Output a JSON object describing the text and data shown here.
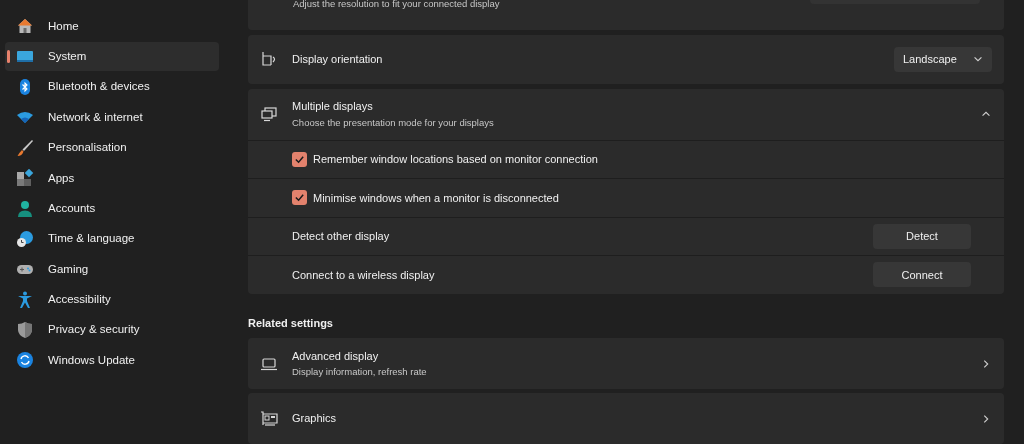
{
  "sidebar": {
    "items": [
      {
        "label": "Home",
        "selected": false
      },
      {
        "label": "System",
        "selected": true
      },
      {
        "label": "Bluetooth & devices",
        "selected": false
      },
      {
        "label": "Network & internet",
        "selected": false
      },
      {
        "label": "Personalisation",
        "selected": false
      },
      {
        "label": "Apps",
        "selected": false
      },
      {
        "label": "Accounts",
        "selected": false
      },
      {
        "label": "Time & language",
        "selected": false
      },
      {
        "label": "Gaming",
        "selected": false
      },
      {
        "label": "Accessibility",
        "selected": false
      },
      {
        "label": "Privacy & security",
        "selected": false
      },
      {
        "label": "Windows Update",
        "selected": false
      }
    ]
  },
  "top_row": {
    "description": "Adjust the resolution to fit your connected display"
  },
  "display_orientation": {
    "title": "Display orientation",
    "value": "Landscape"
  },
  "multiple_displays": {
    "title": "Multiple displays",
    "description": "Choose the presentation mode for your displays",
    "expanded": true,
    "rows": [
      {
        "kind": "checkbox",
        "label": "Remember window locations based on monitor connection",
        "checked": true
      },
      {
        "kind": "checkbox",
        "label": "Minimise windows when a monitor is disconnected",
        "checked": true
      },
      {
        "kind": "button",
        "label": "Detect other display",
        "button": "Detect"
      },
      {
        "kind": "button",
        "label": "Connect to a wireless display",
        "button": "Connect"
      }
    ]
  },
  "related_settings": {
    "heading": "Related settings",
    "items": [
      {
        "title": "Advanced display",
        "description": "Display information, refresh rate"
      },
      {
        "title": "Graphics"
      }
    ]
  }
}
